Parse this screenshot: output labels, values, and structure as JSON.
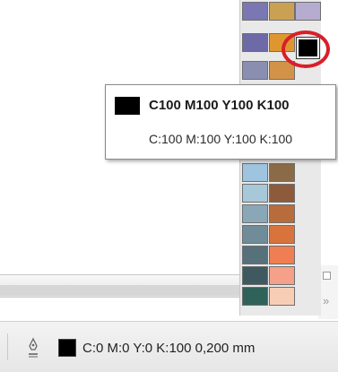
{
  "tooltip": {
    "title": "C100 M100 Y100 K100",
    "subtitle": "C:100 M:100 Y:100 K:100",
    "swatch_color": "#000000"
  },
  "palette": {
    "rows": [
      [
        "#7a77b3",
        "#caa052",
        "#b6acd0"
      ],
      [
        "#6e6aa8",
        "#e0962f",
        "#000000"
      ],
      [
        "#8a8fb2",
        "#d29348",
        ""
      ],
      [
        "#9ec4df",
        "#8b6a48",
        ""
      ],
      [
        "#a7c8d8",
        "#8d5b3b",
        ""
      ],
      [
        "#8aa7b8",
        "#b86c3c",
        ""
      ],
      [
        "#6f8c98",
        "#d9733c",
        ""
      ],
      [
        "#56717a",
        "#ef7e52",
        ""
      ],
      [
        "#3e5a60",
        "#f5a088",
        ""
      ],
      [
        "#2f6259",
        "#f8cdb6",
        ""
      ]
    ],
    "selected_color": "#000000"
  },
  "statusbar": {
    "fill_color": "#000000",
    "readout": "C:0 M:0 Y:0 K:100  0,200 mm"
  },
  "side_panel": {
    "collapse_glyph": "»"
  }
}
